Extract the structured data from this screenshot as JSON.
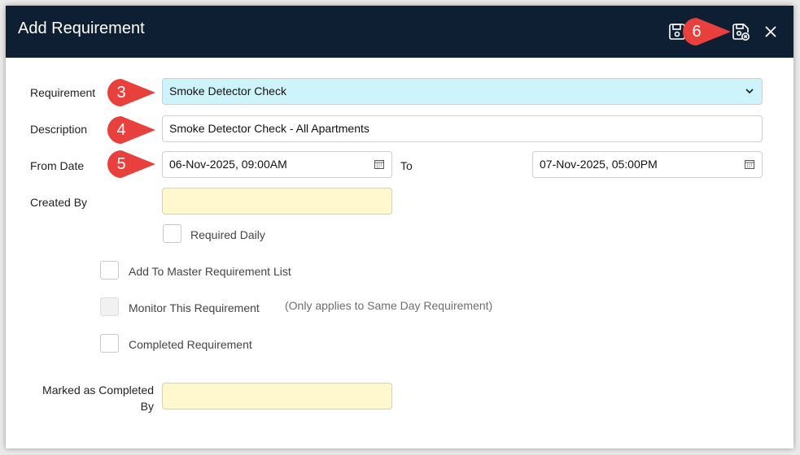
{
  "window": {
    "title": "Add Requirement",
    "icons": [
      "save-icon",
      "save-close-icon",
      "close-icon"
    ]
  },
  "form": {
    "requirement": {
      "label": "Requirement",
      "value": "Smoke Detector Check"
    },
    "description": {
      "label": "Description",
      "value": "Smoke Detector Check - All Apartments"
    },
    "from_date": {
      "label": "From Date",
      "value": "06-Nov-2025, 09:00AM"
    },
    "to_date": {
      "label": "To",
      "value": "07-Nov-2025, 05:00PM"
    },
    "created_by": {
      "label": "Created By",
      "value": ""
    },
    "required_daily": {
      "label": "Required Daily",
      "checked": false
    },
    "add_to_master": {
      "label": "Add To Master Requirement List",
      "checked": false
    },
    "monitor": {
      "label": "Monitor This Requirement",
      "checked": false,
      "note": "(Only applies to Same Day Requirement)"
    },
    "completed": {
      "label": "Completed Requirement",
      "checked": false
    },
    "marked_completed_by": {
      "label_line1": "Marked as Completed",
      "label_line2": "By",
      "value": ""
    }
  },
  "callouts": {
    "requirement": "3",
    "description": "4",
    "from_date": "5",
    "save_close": "6",
    "color": "#e8403d"
  }
}
